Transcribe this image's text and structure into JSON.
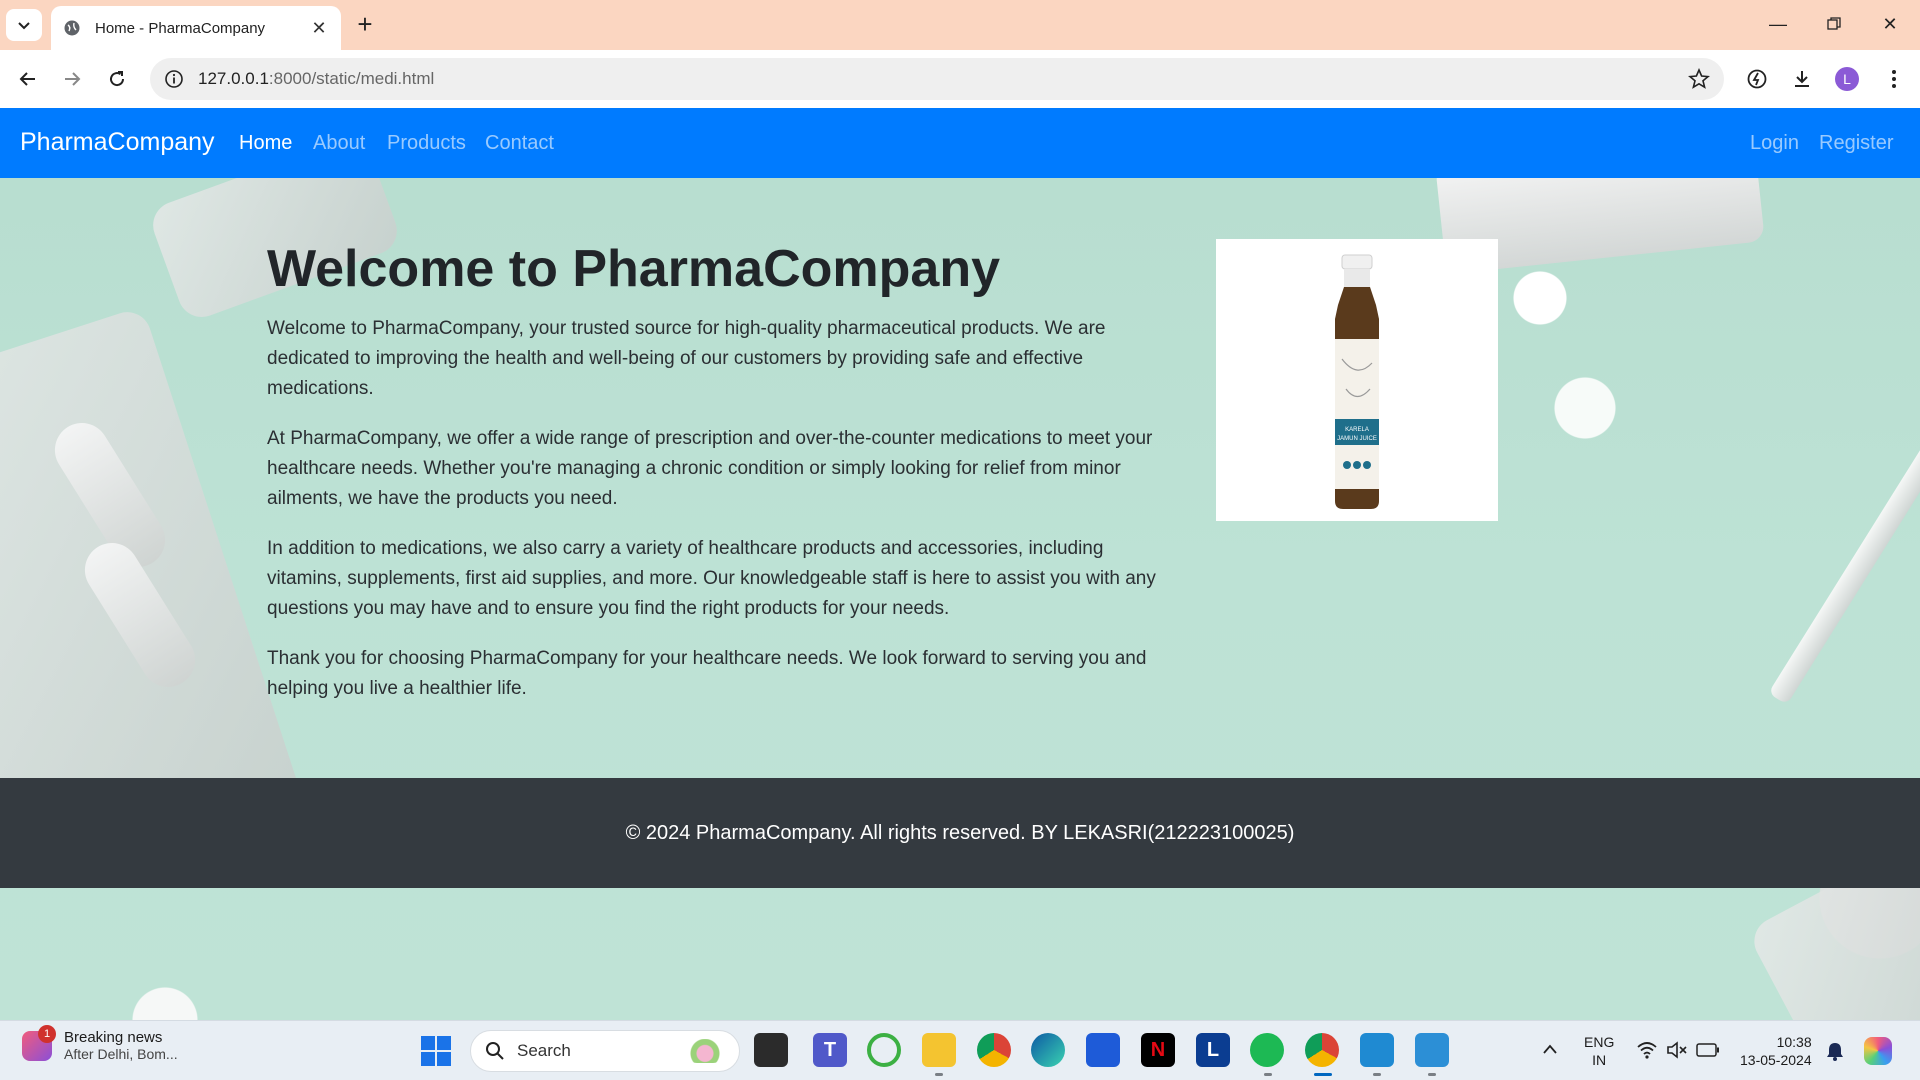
{
  "browser": {
    "tab_title": "Home - PharmaCompany",
    "url_host": "127.0.0.1",
    "url_path": ":8000/static/medi.html"
  },
  "navbar": {
    "brand": "PharmaCompany",
    "links": [
      "Home",
      "About",
      "Products",
      "Contact"
    ],
    "auth": [
      "Login",
      "Register"
    ],
    "color": "#007bff"
  },
  "main": {
    "heading": "Welcome to PharmaCompany",
    "paragraphs": [
      "Welcome to PharmaCompany, your trusted source for high-quality pharmaceutical products. We are dedicated to improving the health and well-being of our customers by providing safe and effective medications.",
      "At PharmaCompany, we offer a wide range of prescription and over-the-counter medications to meet your healthcare needs. Whether you're managing a chronic condition or simply looking for relief from minor ailments, we have the products you need.",
      "In addition to medications, we also carry a variety of healthcare products and accessories, including vitamins, supplements, first aid supplies, and more. Our knowledgeable staff is here to assist you with any questions you may have and to ensure you find the right products for your needs.",
      "Thank you for choosing PharmaCompany for your healthcare needs. We look forward to serving you and helping you live a healthier life."
    ],
    "product_label": "KARELA JAMUN JUICE"
  },
  "footer": {
    "text": "© 2024 PharmaCompany. All rights reserved. BY LEKASRI(212223100025)",
    "color": "#343a40"
  },
  "taskbar": {
    "news_badge": "1",
    "news_title": "Breaking news",
    "news_sub": "After Delhi, Bom...",
    "search_placeholder": "Search",
    "lang_top": "ENG",
    "lang_bottom": "IN",
    "time": "10:38",
    "date": "13-05-2024",
    "profile_initial": "L"
  }
}
